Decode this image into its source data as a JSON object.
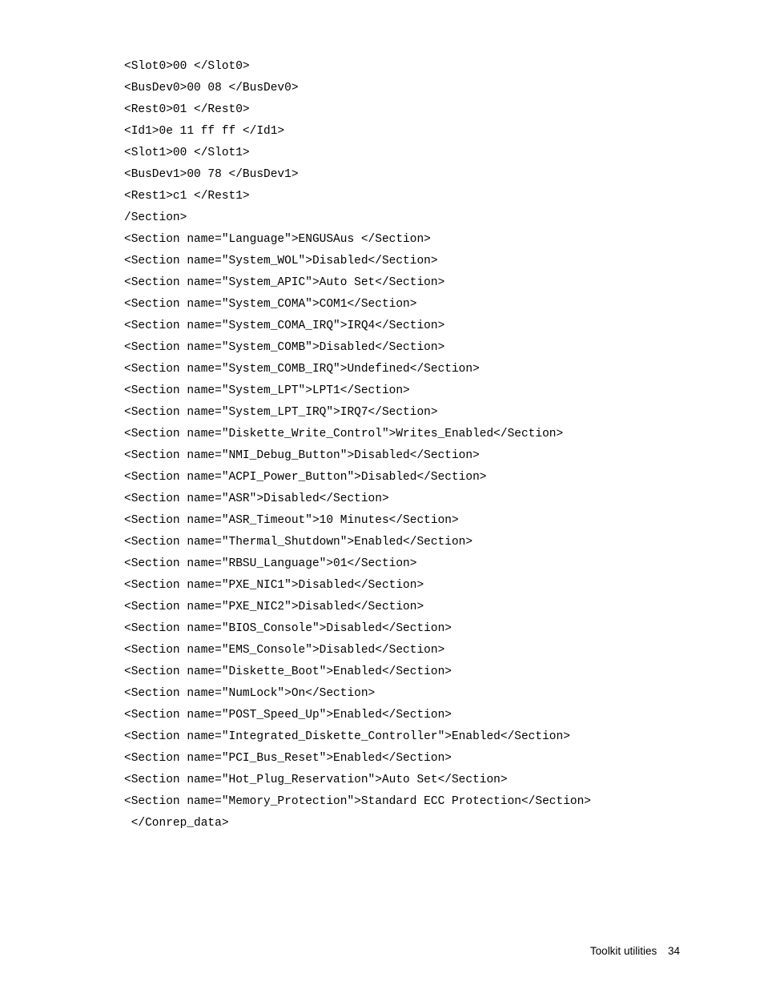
{
  "lines": [
    "<Slot0>00 </Slot0>",
    "<BusDev0>00 08 </BusDev0>",
    "<Rest0>01 </Rest0>",
    "<Id1>0e 11 ff ff </Id1>",
    "<Slot1>00 </Slot1>",
    "<BusDev1>00 78 </BusDev1>",
    "<Rest1>c1 </Rest1>",
    "/Section>",
    "<Section name=\"Language\">ENGUSAus </Section>",
    "<Section name=\"System_WOL\">Disabled</Section>",
    "<Section name=\"System_APIC\">Auto Set</Section>",
    "<Section name=\"System_COMA\">COM1</Section>",
    "<Section name=\"System_COMA_IRQ\">IRQ4</Section>",
    "<Section name=\"System_COMB\">Disabled</Section>",
    "<Section name=\"System_COMB_IRQ\">Undefined</Section>",
    "<Section name=\"System_LPT\">LPT1</Section>",
    "<Section name=\"System_LPT_IRQ\">IRQ7</Section>",
    "<Section name=\"Diskette_Write_Control\">Writes_Enabled</Section>",
    "<Section name=\"NMI_Debug_Button\">Disabled</Section>",
    "<Section name=\"ACPI_Power_Button\">Disabled</Section>",
    "<Section name=\"ASR\">Disabled</Section>",
    "<Section name=\"ASR_Timeout\">10 Minutes</Section>",
    "<Section name=\"Thermal_Shutdown\">Enabled</Section>",
    "<Section name=\"RBSU_Language\">01</Section>",
    "<Section name=\"PXE_NIC1\">Disabled</Section>",
    "<Section name=\"PXE_NIC2\">Disabled</Section>",
    "<Section name=\"BIOS_Console\">Disabled</Section>",
    "<Section name=\"EMS_Console\">Disabled</Section>",
    "<Section name=\"Diskette_Boot\">Enabled</Section>",
    "<Section name=\"NumLock\">On</Section>",
    "<Section name=\"POST_Speed_Up\">Enabled</Section>",
    "<Section name=\"Integrated_Diskette_Controller\">Enabled</Section>",
    "<Section name=\"PCI_Bus_Reset\">Enabled</Section>",
    "<Section name=\"Hot_Plug_Reservation\">Auto Set</Section>",
    "<Section name=\"Memory_Protection\">Standard ECC Protection</Section>",
    " </Conrep_data>"
  ],
  "footer": {
    "label": "Toolkit utilities",
    "page": "34"
  }
}
